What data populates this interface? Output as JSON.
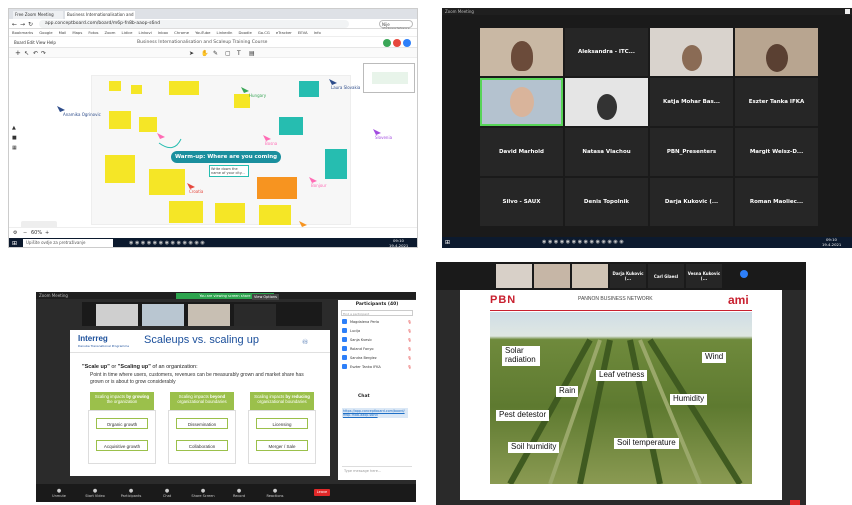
{
  "panel1": {
    "tabs": [
      "Free Zoom Meeting",
      "Business Internationalisation and S..."
    ],
    "url": "app.conceptboard.com/board/m6p-fn8b-aaop-s6nd",
    "bookmarks": [
      "Bookmarks",
      "Google",
      "Mail",
      "Maps",
      "Fotos",
      "Zoom",
      "Lidice",
      "Linkovi",
      "Inbox",
      "Chrome",
      "YouTube",
      "LinkedIn",
      "Doodle",
      "Go.CG",
      "eTracker",
      "EEVA",
      "Info"
    ],
    "board_title": "Business Internationalisation and Scaleup Training Course",
    "warmup": "Warm-up: Where are you coming from?",
    "cursor_names": [
      "Anamika Ogrinovic",
      "Laura Slovakia",
      "Hungary",
      "Slovenia",
      "Croatia",
      "Bosna",
      "Fotos",
      "Slovakia",
      "Czech Republic",
      "Bonjour",
      "Malta",
      "Germany"
    ],
    "taskbar_search": "Upišite ovdje za pretraživanje",
    "time": "09:10",
    "date": "19.4.2021",
    "zoom_pct": "60%",
    "colors": {
      "yellow": "#f5e626",
      "teal": "#26bdb0",
      "pink": "#ff6bb5",
      "orange": "#f79420",
      "arrow": "#2d4c8a"
    }
  },
  "panel2": {
    "title": "Zoom Meeting",
    "participants": [
      {
        "name": "Aleksandra - ITC...",
        "video": false
      },
      {
        "name": "Katja Mohar Bas...",
        "video": false
      },
      {
        "name": "Eszter Tanka IFKA",
        "video": false
      },
      {
        "name": "David Marhold",
        "video": false
      },
      {
        "name": "Natasa Vlachou",
        "video": false
      },
      {
        "name": "PBN_Presenters",
        "video": false
      },
      {
        "name": "Margit Weisz-D...",
        "video": false
      },
      {
        "name": "Silvo - SAUX",
        "video": false
      },
      {
        "name": "Denis Topolnik",
        "video": false
      },
      {
        "name": "Darja Kukovic (...",
        "video": false
      },
      {
        "name": "Roman Maoliec...",
        "video": false
      }
    ],
    "time": "09:10",
    "date": "19.4.2021"
  },
  "panel3": {
    "title": "Zoom Meeting",
    "slide_title": "Scaleups vs. scaling up",
    "logo": "Interreg",
    "logo_sub": "Danube Transnational Programme",
    "intro_bold1": "\"Scale up\"",
    "intro_mid": " or ",
    "intro_bold2": "\"Scaling up\"",
    "intro_rest": " of an organization:",
    "bullet": "Point in time where users, customers, revenues can be measurably grown and market share has grown or is about to grow considerably",
    "boxes": [
      {
        "pre": "Scaling impacts ",
        "emph": "by growing",
        "post": " the organization",
        "items": [
          "Organic growth",
          "Acquisitive growth"
        ]
      },
      {
        "pre": "Scaling impacts ",
        "emph": "beyond",
        "post": " organizational boundaries",
        "items": [
          "Dissemination",
          "Collaboration"
        ]
      },
      {
        "pre": "Scaling impacts ",
        "emph": "by reducing",
        "post": " organizational boundaries",
        "items": [
          "Licensing",
          "Merger / Sale"
        ]
      }
    ],
    "participants_header": "Participants (40)",
    "participant_list": [
      "Magdalena Perla",
      "Lucija",
      "Sanja Kvesic",
      "Roland Fonyo",
      "Sandra Berglez",
      "Eszter Tanka IFKA"
    ],
    "chat_header": "Chat",
    "chat_message": "https://app.conceptboard.com/board/m6p-fn8b-aaop-s6nd",
    "chat_placeholder": "Type message here...",
    "toolbar": [
      "Unmute",
      "Start Video",
      "Participants",
      "Chat",
      "Share Screen",
      "Record",
      "Reactions",
      "Leave"
    ],
    "leave_label": "Leave",
    "view_options": "View Options"
  },
  "panel4": {
    "title": "Zoom Meeting",
    "strip_names": [
      "Darja Kukovic (...",
      "Carl Glaesl",
      "Vesna Kukovic (..."
    ],
    "pbn": "PBN",
    "network": "PANNON BUSINESS NETWORK",
    "ami": "ami",
    "labels": [
      "Solar radiation",
      "Wind",
      "Leaf vetness",
      "Rain",
      "Humidity",
      "Pest detestor",
      "Soil humidity",
      "Soil temperature"
    ],
    "colors": {
      "pbn_red": "#c8202f",
      "sky": "#cfdde6",
      "field": "#6f8a3c"
    }
  }
}
